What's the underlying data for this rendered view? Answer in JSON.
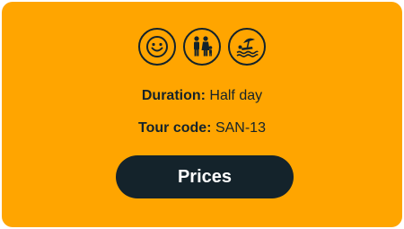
{
  "card": {
    "background_color": "#ffa500",
    "text_color": "#14232b",
    "icons": [
      {
        "name": "smiley-face-icon"
      },
      {
        "name": "family-icon"
      },
      {
        "name": "beach-umbrella-icon"
      }
    ],
    "duration": {
      "label": "Duration:",
      "value": "Half day"
    },
    "tour_code": {
      "label": "Tour code:",
      "value": "SAN-13"
    },
    "prices_button": {
      "label": "Prices",
      "background_color": "#14232b",
      "text_color": "#ffffff"
    }
  }
}
